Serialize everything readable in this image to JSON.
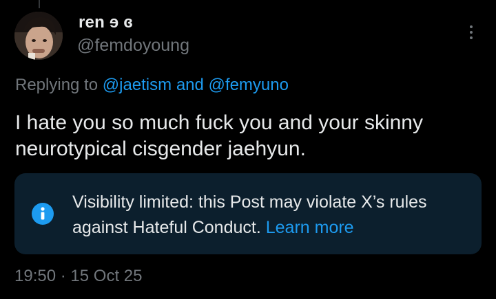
{
  "user": {
    "display_name": "ren ɘ ɞ",
    "handle": "@femdoyoung"
  },
  "reply": {
    "prefix": "Replying to",
    "mention_1": "@jaetism",
    "connector": "and",
    "mention_2": "@femyuno"
  },
  "tweet": {
    "text": "I hate you so much fuck you and your skinny neurotypical cisgender jaehyun."
  },
  "notice": {
    "text": "Visibility limited: this Post may violate X’s rules against Hateful Conduct.",
    "link_label": "Learn more",
    "icon": "info-icon"
  },
  "meta": {
    "time": "19:50",
    "separator": "·",
    "date": "15 Oct 25"
  },
  "colors": {
    "background": "#000000",
    "text": "#e7e9ea",
    "muted": "#71767b",
    "accent": "#1d9bf0",
    "notice_bg": "#0c1f2d"
  },
  "icons": {
    "more": "more-vertical-icon"
  }
}
